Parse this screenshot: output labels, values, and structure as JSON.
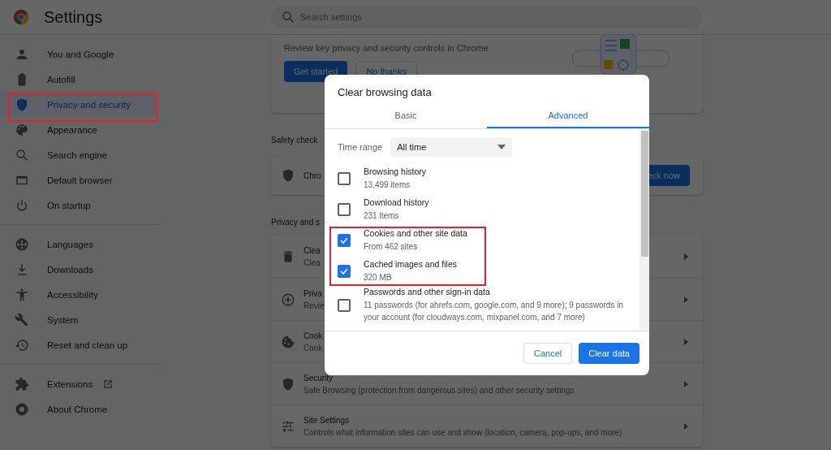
{
  "header": {
    "title": "Settings",
    "search": {
      "placeholder": "Search settings"
    }
  },
  "sidebar": {
    "groups": [
      [
        {
          "label": "You and Google",
          "selected": false
        },
        {
          "label": "Autofill",
          "selected": false
        },
        {
          "label": "Privacy and security",
          "selected": true
        },
        {
          "label": "Appearance",
          "selected": false
        },
        {
          "label": "Search engine",
          "selected": false
        },
        {
          "label": "Default browser",
          "selected": false
        },
        {
          "label": "On startup",
          "selected": false
        }
      ],
      [
        {
          "label": "Languages",
          "selected": false
        },
        {
          "label": "Downloads",
          "selected": false
        },
        {
          "label": "Accessibility",
          "selected": false
        },
        {
          "label": "System",
          "selected": false
        },
        {
          "label": "Reset and clean up",
          "selected": false
        }
      ],
      [
        {
          "label": "Extensions",
          "selected": false
        },
        {
          "label": "About Chrome",
          "selected": false
        }
      ]
    ]
  },
  "main": {
    "intro_card": {
      "description": "Review key privacy and security controls in Chrome",
      "buttons": [
        "Get started",
        "No thanks"
      ]
    },
    "safety_check": {
      "heading": "Safety check",
      "row_text": "Chro",
      "button": "eck now"
    },
    "privacy": {
      "heading": "Privacy and s",
      "rows": [
        {
          "title": "Clea",
          "subtitle": "Clea"
        },
        {
          "title": "Priva",
          "subtitle": "Revie"
        },
        {
          "title": "Cook",
          "subtitle": "Cook"
        },
        {
          "title": "Security",
          "subtitle": "Safe Browsing (protection from dangerous sites) and other security settings"
        },
        {
          "title": "Site Settings",
          "subtitle": "Controls what information sites can use and show (location, camera, pop-ups, and more)"
        }
      ]
    }
  },
  "dialog": {
    "title": "Clear browsing data",
    "tabs": [
      {
        "label": "Basic",
        "selected": false
      },
      {
        "label": "Advanced",
        "selected": true
      }
    ],
    "time_range": {
      "label": "Time range",
      "value": "All time"
    },
    "options": [
      {
        "title": "Browsing history",
        "detail": "13,499 items",
        "checked": false
      },
      {
        "title": "Download history",
        "detail": "231 items",
        "checked": false
      },
      {
        "title": "Cookies and other site data",
        "detail": "From 462 sites",
        "checked": true
      },
      {
        "title": "Cached images and files",
        "detail": "320 MB",
        "checked": true
      },
      {
        "title": "Passwords and other sign-in data",
        "detail": "11 passwords (for ahrefs.com, google.com, and 9 more); 9 passwords in your account (for cloudways.com, mixpanel.com, and 7 more)",
        "checked": false
      }
    ],
    "buttons": [
      "Cancel",
      "Clear data"
    ]
  }
}
